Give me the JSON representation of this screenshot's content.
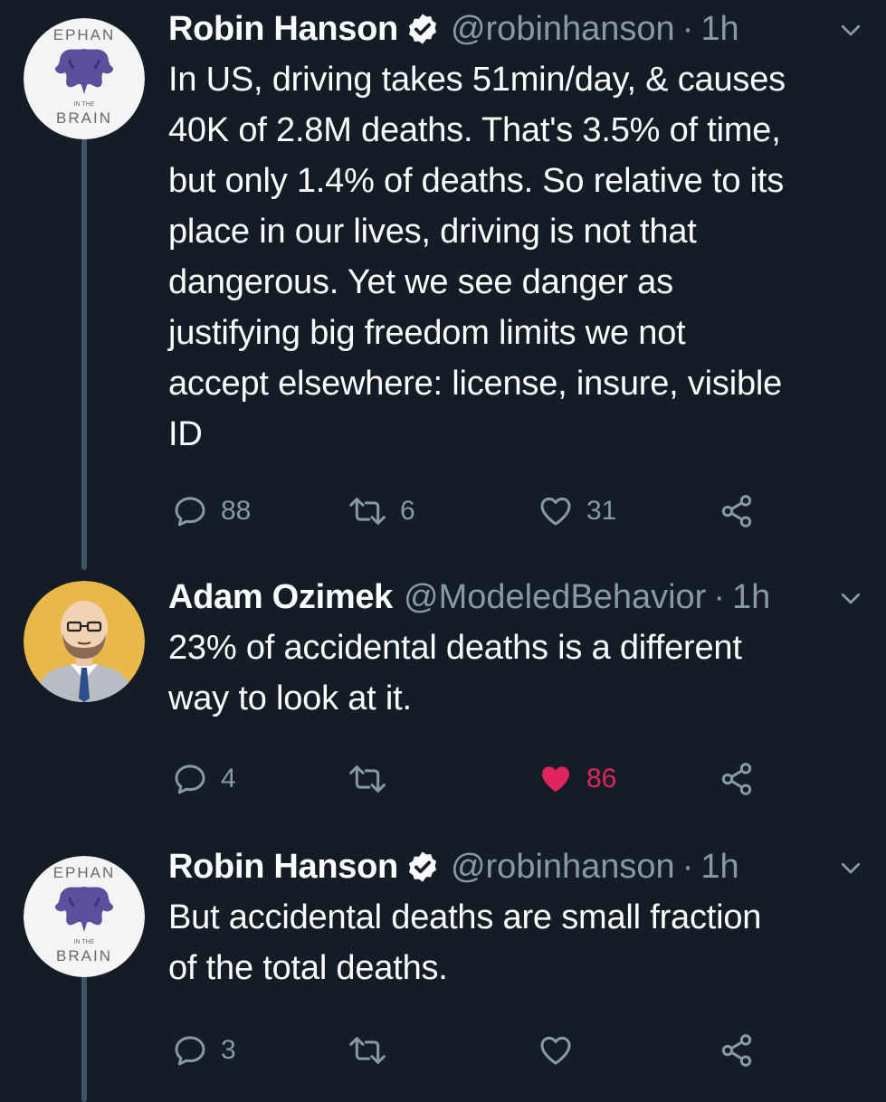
{
  "colors": {
    "background": "#141d26",
    "text": "#ffffff",
    "secondary": "#8899a6",
    "thread_line": "#3d5466",
    "like_active": "#e0245e"
  },
  "tweets": [
    {
      "name": "Robin Hanson",
      "verified": true,
      "handle": "@robinhanson",
      "separator": "·",
      "time": "1h",
      "avatar": {
        "top_text": "EPHAN",
        "middle_text": "IN THE",
        "bottom_text": "BRAIN",
        "icon": "rorschach-avatar-icon"
      },
      "text_lines": [
        "In US, driving takes 51min/day, & causes",
        "40K of 2.8M deaths. That's 3.5% of time,",
        "but only 1.4% of deaths. So relative to its",
        "place in our lives, driving is not that",
        "dangerous. Yet we see danger as",
        "justifying big freedom limits we not",
        "accept elsewhere: license, insure, visible",
        "ID"
      ],
      "actions": {
        "replies": "88",
        "retweets": "6",
        "likes": "31",
        "liked": false
      }
    },
    {
      "name": "Adam Ozimek",
      "verified": false,
      "handle": "@ModeledBehavior",
      "separator": "·",
      "time": "1h",
      "avatar": {
        "icon": "cartoon-man-avatar-icon"
      },
      "text_lines": [
        "23% of accidental deaths is a different",
        "way to look at it."
      ],
      "actions": {
        "replies": "4",
        "retweets": "",
        "likes": "86",
        "liked": true
      }
    },
    {
      "name": "Robin Hanson",
      "verified": true,
      "handle": "@robinhanson",
      "separator": "·",
      "time": "1h",
      "avatar": {
        "top_text": "EPHAN",
        "middle_text": "IN THE",
        "bottom_text": "BRAIN",
        "icon": "rorschach-avatar-icon"
      },
      "text_lines": [
        "But accidental deaths are small fraction",
        "of the total deaths."
      ],
      "actions": {
        "replies": "3",
        "retweets": "",
        "likes": "",
        "liked": false
      }
    }
  ]
}
